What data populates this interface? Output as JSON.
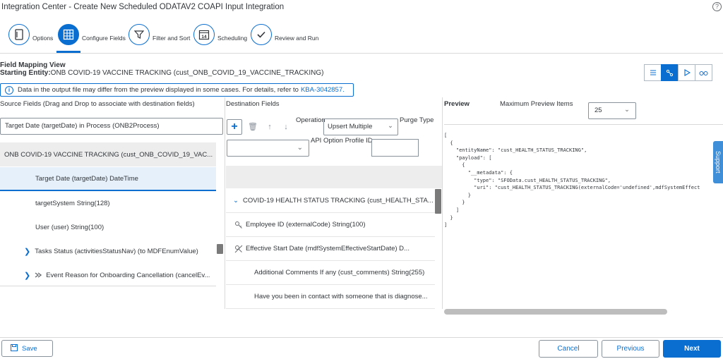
{
  "window": {
    "title": "Integration Center - Create New Scheduled ODATAV2 COAPI Input Integration",
    "help_icon": "?"
  },
  "steps": [
    {
      "label": "Options",
      "icon": "document-icon"
    },
    {
      "label": "Configure Fields",
      "icon": "table-grid-icon"
    },
    {
      "label": "Filter and Sort",
      "icon": "filter-icon"
    },
    {
      "label": "Scheduling",
      "icon": "calendar-icon",
      "badge": "14"
    },
    {
      "label": "Review and Run",
      "icon": "checkmark-icon"
    }
  ],
  "field_mapping": {
    "title": "Field Mapping View",
    "entity_label": "Starting Entity:",
    "entity_value": "ONB COVID-19 VACCINE TRACKING (cust_ONB_COVID_19_VACCINE_TRACKING)"
  },
  "info": {
    "text": "Data in the output file may differ from the preview displayed in some cases. For details, refer to",
    "link": "KBA-3042857."
  },
  "source": {
    "header": "Source Fields (Drag and Drop to associate with destination fields)",
    "input_value": "Target Date (targetDate) in Process (ONB2Process)",
    "group": "ONB COVID-19 VACCINE TRACKING (cust_ONB_COVID_19_VAC...",
    "rows": [
      "Target Date (targetDate) DateTime",
      "targetSystem String(128)",
      "User (user) String(100)",
      "Tasks Status (activitiesStatusNav) (to MDFEnumValue)",
      "Event Reason for Onboarding Cancellation (cancelEv..."
    ]
  },
  "destination": {
    "header": "Destination Fields",
    "operation_label": "Operation",
    "operation_value": "Upsert Multiple",
    "purge_label": "Purge Type",
    "api_label": "API Option Profile ID",
    "group": "COVID-19 HEALTH STATUS TRACKING (cust_HEALTH_STA...",
    "rows": [
      "Employee ID (externalCode) String(100)",
      "Effective Start Date (mdfSystemEffectiveStartDate) D...",
      "Additional Comments If any (cust_comments) String(255)",
      "Have you been in contact with someone that is diagnose..."
    ]
  },
  "preview": {
    "header": "Preview",
    "max_label": "Maximum Preview Items",
    "max_value": "25",
    "code": "[\n  {\n    \"entityName\": \"cust_HEALTH_STATUS_TRACKING\",\n    \"payload\": [\n      {\n        \"__metadata\": {\n          \"type\": \"SFOData.cust_HEALTH_STATUS_TRACKING\",\n          \"uri\": \"cust_HEALTH_STATUS_TRACKING(externalCode='undefined',mdfSystemEffect\n        }\n      }\n    ]\n  }\n]"
  },
  "support_label": "Support",
  "footer": {
    "save": "Save",
    "cancel": "Cancel",
    "previous": "Previous",
    "next": "Next"
  },
  "colors": {
    "accent": "#0a6ed1",
    "group_bg": "#ededed",
    "selected_bg": "#e5f0fa"
  }
}
